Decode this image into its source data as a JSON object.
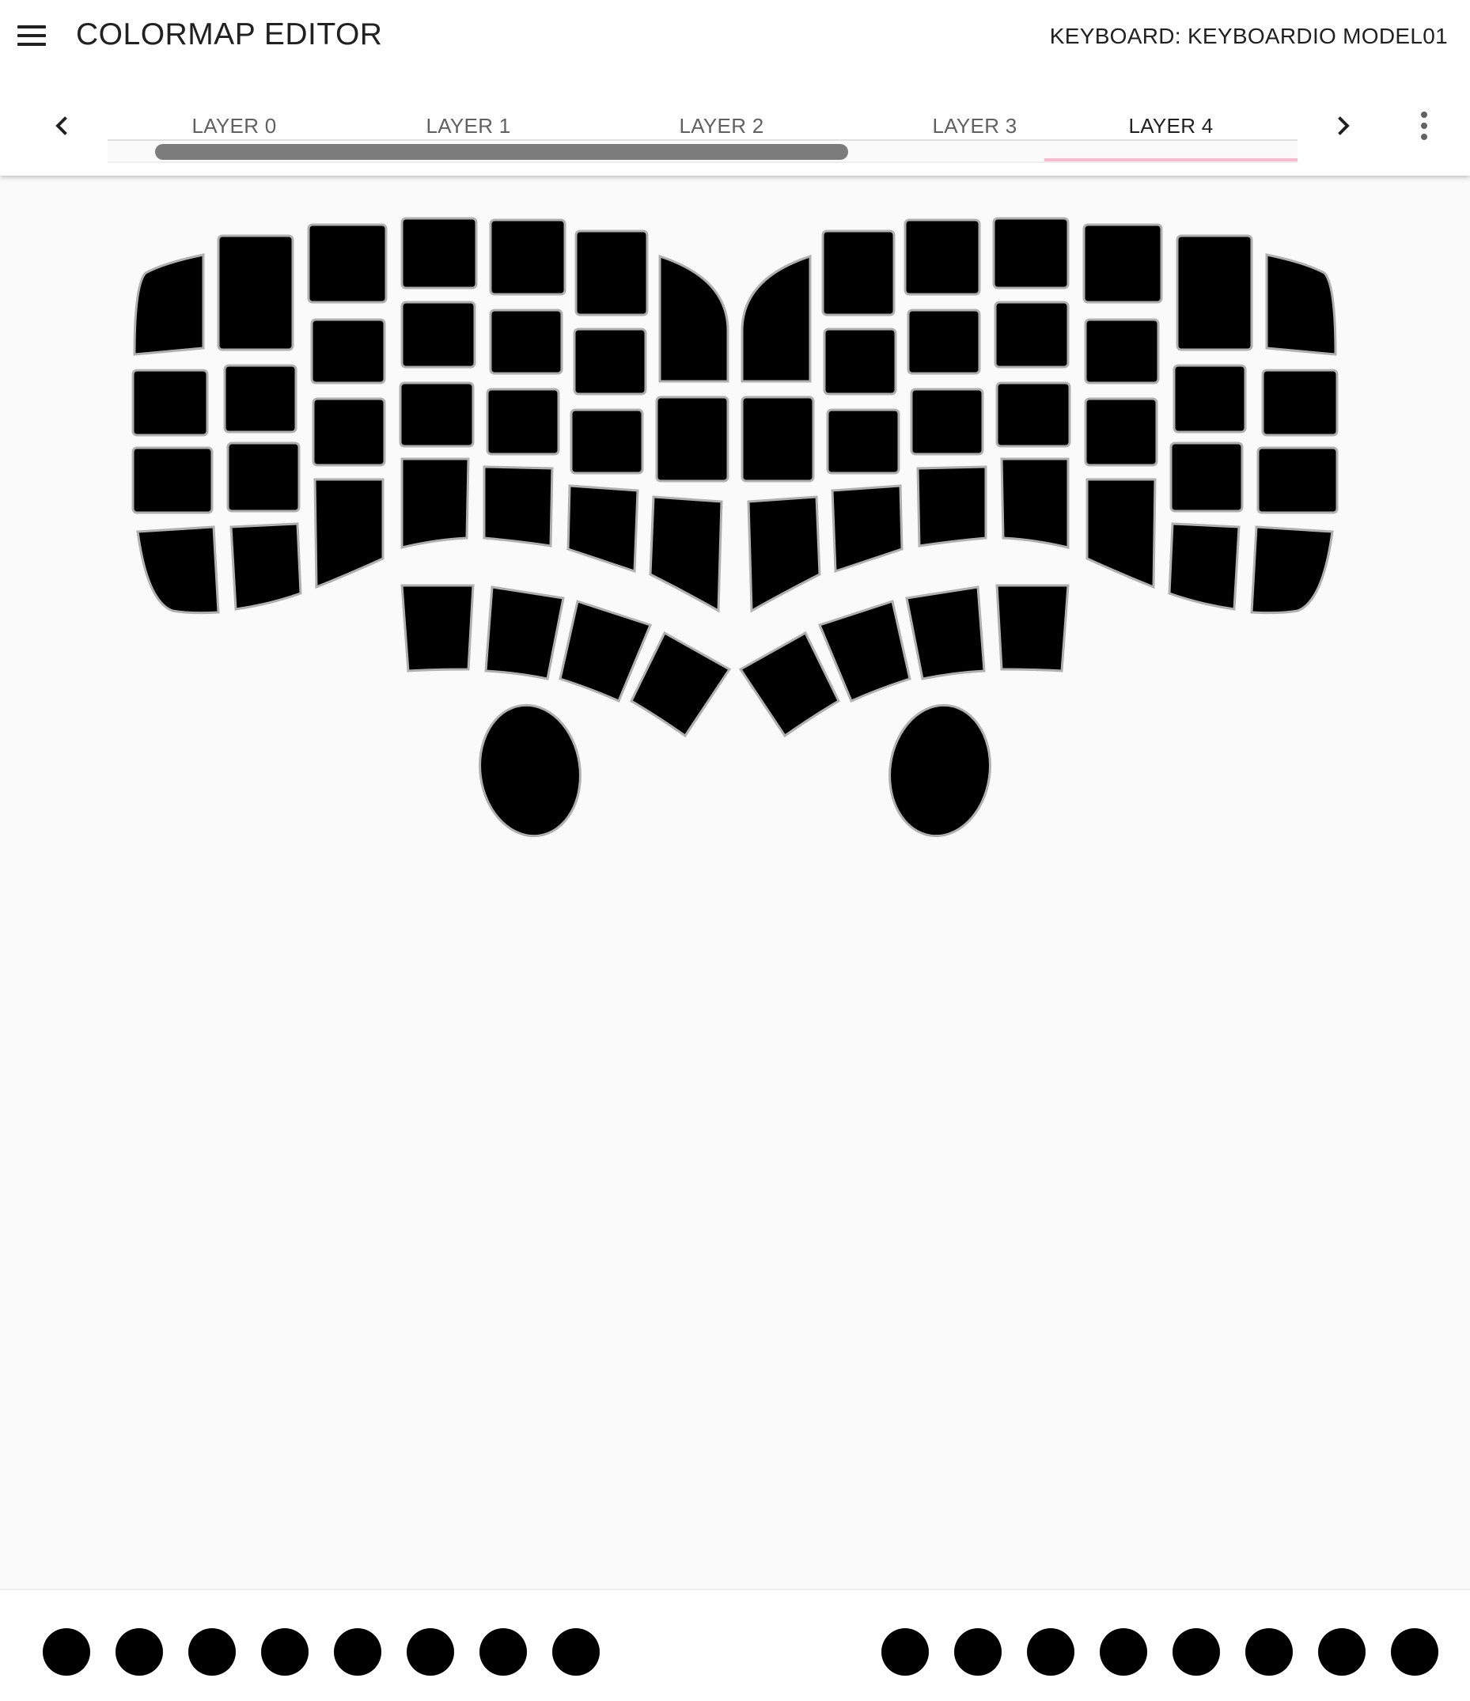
{
  "app_bar": {
    "title": "COLORMAP EDITOR",
    "keyboard_label": "KEYBOARD: KEYBOARDIO MODEL01",
    "menu_icon": "hamburger-menu-icon"
  },
  "tabs": {
    "prev_icon": "chevron-left-icon",
    "next_icon": "chevron-right-icon",
    "more_icon": "more-vert-icon",
    "items": [
      {
        "label": "LAYER 0",
        "active": false
      },
      {
        "label": "LAYER 1",
        "active": false
      },
      {
        "label": "LAYER 2",
        "active": false
      },
      {
        "label": "LAYER 3",
        "active": false
      },
      {
        "label": "LAYER 4",
        "active": true
      }
    ],
    "indicator_color": "#f8bbd0"
  },
  "keyboard": {
    "key_color": "#000000",
    "key_border_color": "#b0b0b0"
  },
  "palette": {
    "swatches": [
      "#000000",
      "#000000",
      "#000000",
      "#000000",
      "#000000",
      "#000000",
      "#000000",
      "#000000",
      "#000000",
      "#000000",
      "#000000",
      "#000000",
      "#000000",
      "#000000",
      "#000000",
      "#000000"
    ]
  },
  "colors": {
    "background": "#fafafa",
    "app_bar": "#ffffff",
    "text_primary": "#212121",
    "text_secondary": "#616161"
  }
}
